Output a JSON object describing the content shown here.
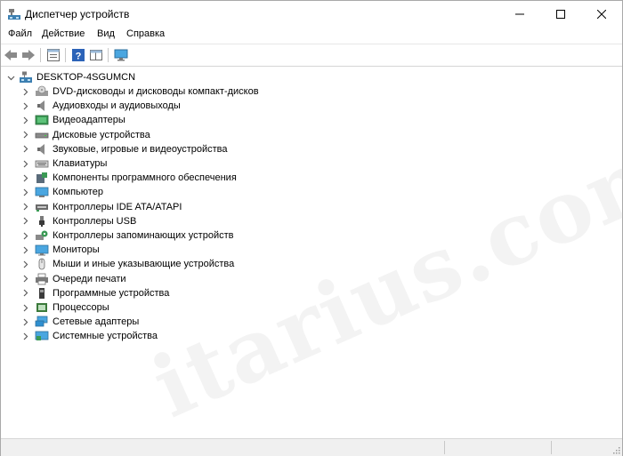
{
  "window": {
    "title": "Диспетчер устройств"
  },
  "menu": {
    "items": [
      "Файл",
      "Действие",
      "Вид",
      "Справка"
    ]
  },
  "toolbar": {
    "buttons": [
      "back-arrow",
      "forward-arrow",
      "properties",
      "help",
      "show-hide-console-tree",
      "monitor-scan"
    ]
  },
  "tree": {
    "root": "DESKTOP-4SGUMCN",
    "items": [
      {
        "label": "DVD-дисководы и дисководы компакт-дисков",
        "icon": "dvd-drive-icon"
      },
      {
        "label": "Аудиовходы и аудиовыходы",
        "icon": "speaker-icon"
      },
      {
        "label": "Видеоадаптеры",
        "icon": "display-adapter-icon"
      },
      {
        "label": "Дисковые устройства",
        "icon": "disk-drive-icon"
      },
      {
        "label": "Звуковые, игровые и видеоустройства",
        "icon": "speaker-icon"
      },
      {
        "label": "Клавиатуры",
        "icon": "keyboard-icon"
      },
      {
        "label": "Компоненты программного обеспечения",
        "icon": "software-component-icon"
      },
      {
        "label": "Компьютер",
        "icon": "computer-icon"
      },
      {
        "label": "Контроллеры IDE ATA/ATAPI",
        "icon": "ide-controller-icon"
      },
      {
        "label": "Контроллеры USB",
        "icon": "usb-icon"
      },
      {
        "label": "Контроллеры запоминающих устройств",
        "icon": "storage-controller-icon"
      },
      {
        "label": "Мониторы",
        "icon": "monitor-icon"
      },
      {
        "label": "Мыши и иные указывающие устройства",
        "icon": "mouse-icon"
      },
      {
        "label": "Очереди печати",
        "icon": "printer-icon"
      },
      {
        "label": "Программные устройства",
        "icon": "software-device-icon"
      },
      {
        "label": "Процессоры",
        "icon": "processor-icon"
      },
      {
        "label": "Сетевые адаптеры",
        "icon": "network-adapter-icon"
      },
      {
        "label": "Системные устройства",
        "icon": "system-device-icon"
      }
    ]
  },
  "watermark": "itarius.com",
  "colors": {
    "accent": "#0078d7",
    "chevron": "#5a5a5a"
  }
}
